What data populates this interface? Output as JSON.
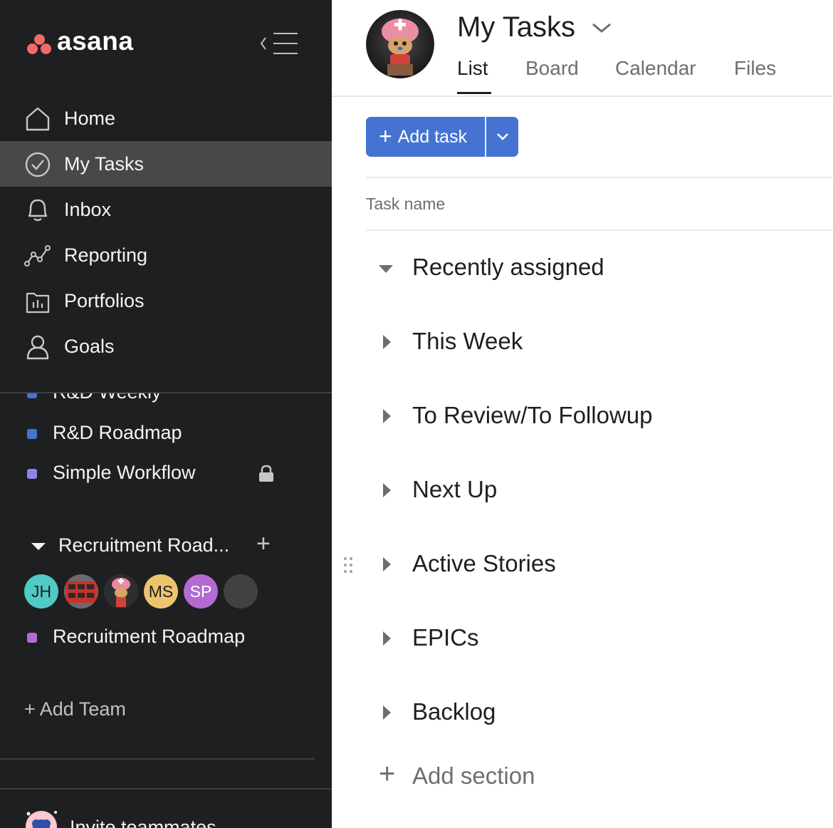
{
  "app": {
    "logo_text": "asana",
    "brand_color": "#f06a6a",
    "accent_color": "#4573d2"
  },
  "sidebar": {
    "collapse_icon": "collapse-sidebar-icon",
    "nav": [
      {
        "label": "Home",
        "icon": "home-icon",
        "active": false
      },
      {
        "label": "My Tasks",
        "icon": "check-circle-icon",
        "active": true
      },
      {
        "label": "Inbox",
        "icon": "bell-icon",
        "active": false
      },
      {
        "label": "Reporting",
        "icon": "line-chart-icon",
        "active": false
      },
      {
        "label": "Portfolios",
        "icon": "folder-chart-icon",
        "active": false
      },
      {
        "label": "Goals",
        "icon": "person-icon",
        "active": false
      }
    ],
    "projects": [
      {
        "label": "R&D Weekly",
        "color": "#4573d2"
      },
      {
        "label": "R&D Roadmap",
        "color": "#4573d2"
      },
      {
        "label": "Simple Workflow",
        "color": "#8d84e8",
        "locked": true
      }
    ],
    "team": {
      "name": "Recruitment Road...",
      "add_label": "+",
      "members": [
        {
          "initials": "JH",
          "color": "#4ecbc4"
        },
        {
          "initials": "",
          "color": "#b8302a",
          "kind": "photo-bus"
        },
        {
          "initials": "",
          "color": "#3a3a3a",
          "kind": "photo-chopper"
        },
        {
          "initials": "MS",
          "color": "#eec36e"
        },
        {
          "initials": "SP",
          "color": "#b36bd4"
        },
        {
          "initials": "",
          "color": "#424244"
        }
      ],
      "projects": [
        {
          "label": "Recruitment Roadmap",
          "color": "#b36bd4"
        }
      ]
    },
    "add_team_label": "+ Add Team",
    "invite_label": "Invite teammates"
  },
  "main": {
    "title": "My Tasks",
    "tabs": [
      {
        "label": "List",
        "active": true
      },
      {
        "label": "Board",
        "active": false
      },
      {
        "label": "Calendar",
        "active": false
      },
      {
        "label": "Files",
        "active": false
      }
    ],
    "add_task": {
      "label": "Add task",
      "plus": "+"
    },
    "column_header": "Task name",
    "sections": [
      {
        "label": "Recently assigned",
        "expanded": true
      },
      {
        "label": "This Week",
        "expanded": false
      },
      {
        "label": "To Review/To Followup",
        "expanded": false
      },
      {
        "label": "Next Up",
        "expanded": false
      },
      {
        "label": "Active Stories",
        "expanded": false
      },
      {
        "label": "EPICs",
        "expanded": false
      },
      {
        "label": "Backlog",
        "expanded": false
      }
    ],
    "add_section": {
      "plus": "+",
      "label": "Add section"
    }
  }
}
